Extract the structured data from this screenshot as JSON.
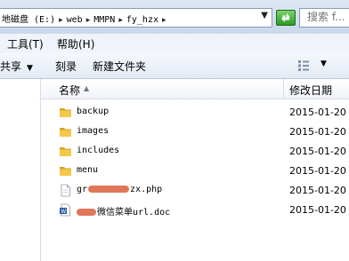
{
  "address_bar": {
    "crumbs": [
      "地磁盘 (E:)",
      "web",
      "MMPN",
      "fy_hzx"
    ],
    "separator": "▸"
  },
  "search": {
    "placeholder": "搜索 f..."
  },
  "menu": [
    {
      "label": "工具(T)"
    },
    {
      "label": "帮助(H)"
    }
  ],
  "toolbar": [
    {
      "label": "共享",
      "has_dropdown": true
    },
    {
      "label": "刻录",
      "has_dropdown": false
    },
    {
      "label": "新建文件夹",
      "has_dropdown": false
    }
  ],
  "columns": {
    "name": "名称",
    "date": "修改日期"
  },
  "files": [
    {
      "name": "backup",
      "date": "2015-01-20",
      "icon": "folder-icon"
    },
    {
      "name": "images",
      "date": "2015-01-20",
      "icon": "folder-icon"
    },
    {
      "name": "includes",
      "date": "2015-01-20",
      "icon": "folder-icon"
    },
    {
      "name": "menu",
      "date": "2015-01-20",
      "icon": "folder-icon"
    },
    {
      "name_prefix": "gr",
      "name_suffix": "zx.php",
      "date": "2015-01-20",
      "icon": "php-file-icon"
    },
    {
      "name_prefix": "",
      "name_suffix": "微信菜单url.doc",
      "date": "2015-01-20",
      "icon": "word-doc-icon"
    }
  ],
  "colors": {
    "folder": "#e8b73a",
    "refresh_green": "#2c9a24",
    "redaction": "#d9603b"
  }
}
